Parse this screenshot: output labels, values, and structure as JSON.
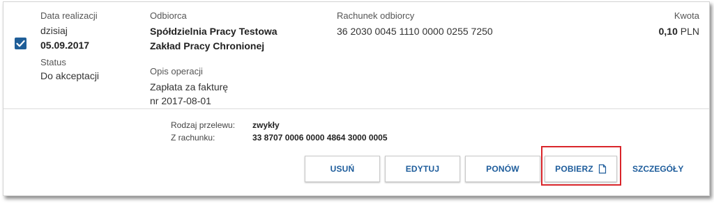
{
  "transfer": {
    "date_label": "Data realizacji",
    "date_relative": "dzisiaj",
    "date_value": "05.09.2017",
    "status_label": "Status",
    "status_value": "Do akceptacji",
    "recipient_label": "Odbiorca",
    "recipient_line1": "Spółdzielnia Pracy Testowa",
    "recipient_line2": "Zakład Pracy Chronionej",
    "account_label": "Rachunek odbiorcy",
    "account_value": "36 2030 0045 1110 0000 0255 7250",
    "amount_label": "Kwota",
    "amount_value": "0,10",
    "amount_currency": "PLN",
    "description_label": "Opis operacji",
    "description_line1": "Zapłata za fakturę",
    "description_line2": "nr 2017-08-01"
  },
  "details": {
    "type_label": "Rodzaj przelewu:",
    "type_value": "zwykły",
    "from_label": "Z rachunku:",
    "from_value": "33 8707 0006 0000 4864 3000 0005"
  },
  "actions": {
    "delete": "USUŃ",
    "edit": "EDYTUJ",
    "repeat": "PONÓW",
    "download": "POBIERZ",
    "details": "SZCZEGÓŁY"
  },
  "icons": {
    "checkbox": "checkmark-icon",
    "download": "document-icon"
  },
  "colors": {
    "accent": "#1d5c9b",
    "checkbox": "#1f5e98",
    "highlight": "#d9252a"
  }
}
